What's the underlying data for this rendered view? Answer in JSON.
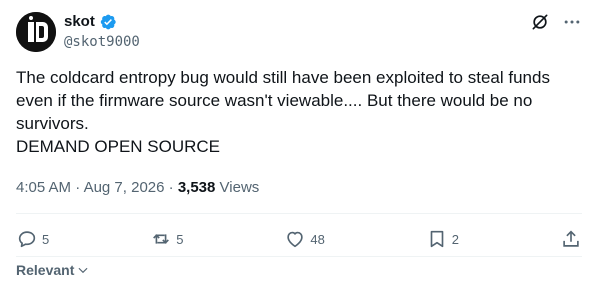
{
  "author": {
    "display_name": "skot",
    "handle": "@skot9000",
    "avatar_icon": "avatar-logo-icon",
    "verified_color": "#1d9bf0"
  },
  "tweet": {
    "text": "The coldcard entropy bug would still have been exploited to steal funds even if the firmware source wasn't viewable.... But there would be no survivors.\nDEMAND OPEN SOURCE",
    "time": "4:05 AM",
    "separator": "·",
    "date": "Aug 7, 2026",
    "views_count": "3,538",
    "views_label": "Views"
  },
  "actions": {
    "replies": "5",
    "reposts": "5",
    "likes": "48",
    "bookmarks": "2"
  },
  "sort": {
    "label": "Relevant"
  },
  "colors": {
    "text": "#0f1419",
    "muted": "#536471",
    "divider": "#eff3f4"
  }
}
